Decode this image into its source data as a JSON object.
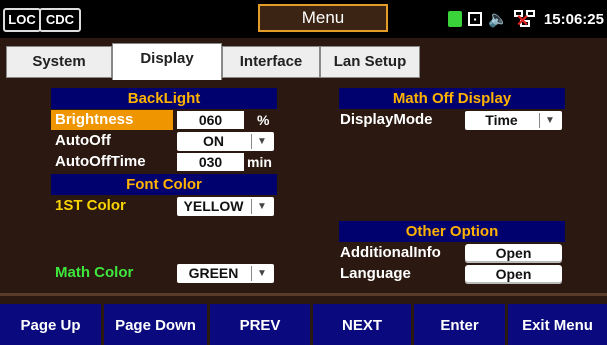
{
  "status": {
    "loc_label": "LOC",
    "cdc_label": "CDC",
    "menu_title": "Menu",
    "clock": "15:06:25",
    "colors": {
      "battery": "#3ad33a",
      "network_error": "#e02020",
      "menu_border": "#e49c28"
    }
  },
  "tabs": [
    {
      "label": "System"
    },
    {
      "label": "Display"
    },
    {
      "label": "Interface"
    },
    {
      "label": "Lan Setup"
    }
  ],
  "active_tab": "Display",
  "backlight": {
    "header": "BackLight",
    "brightness_label": "Brightness",
    "brightness_value": "060",
    "brightness_unit": "%",
    "autooff_label": "AutoOff",
    "autooff_value": "ON",
    "autoofftime_label": "AutoOffTime",
    "autoofftime_value": "030",
    "autoofftime_unit": "min"
  },
  "font_color": {
    "header": "Font Color",
    "first_label": "1ST Color",
    "first_value": "YELLOW",
    "math_label": "Math Color",
    "math_value": "GREEN"
  },
  "math_off": {
    "header": "Math Off Display",
    "mode_label": "DisplayMode",
    "mode_value": "Time"
  },
  "other": {
    "header": "Other Option",
    "additional_label": "AdditionalInfo",
    "additional_button": "Open",
    "language_label": "Language",
    "language_button": "Open"
  },
  "softkeys": [
    {
      "label": "Page Up"
    },
    {
      "label": "Page Down"
    },
    {
      "label": "PREV"
    },
    {
      "label": "NEXT"
    },
    {
      "label": "Enter"
    },
    {
      "label": "Exit Menu"
    }
  ],
  "colors": {
    "header_bg": "#00006e",
    "header_text": "#ffb300",
    "selected_bg": "#ef9500",
    "first_color_text": "#f7d400",
    "math_color_text": "#3ee63e",
    "panel_bg": "#2b1810",
    "softkey_bg": "#0a0a7e"
  }
}
